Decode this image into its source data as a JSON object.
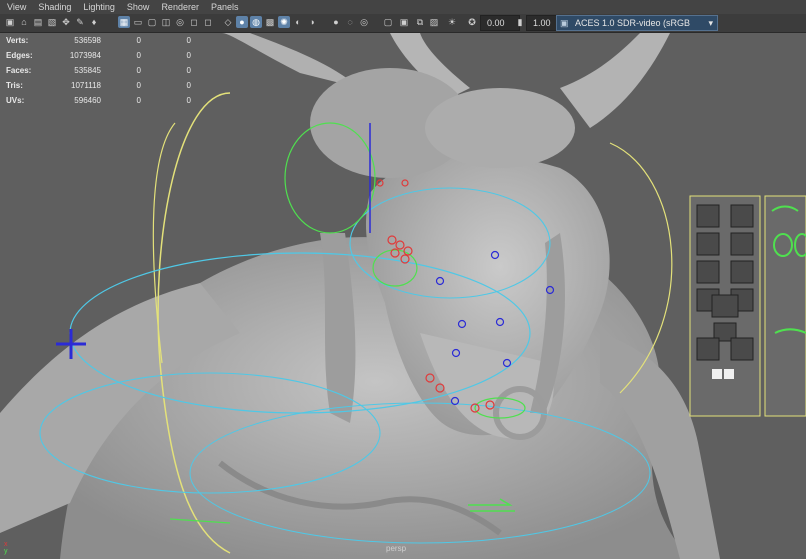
{
  "menu": [
    "View",
    "Shading",
    "Lighting",
    "Show",
    "Renderer",
    "Panels"
  ],
  "toolbar": {
    "exposure": "0.00",
    "gamma": "1.00",
    "colorspace": "ACES 1.0 SDR-video (sRGB"
  },
  "hud": {
    "rows": [
      {
        "label": "Verts:",
        "a": "536598",
        "b": "0",
        "c": "0"
      },
      {
        "label": "Edges:",
        "a": "1073984",
        "b": "0",
        "c": "0"
      },
      {
        "label": "Faces:",
        "a": "535845",
        "b": "0",
        "c": "0"
      },
      {
        "label": "Tris:",
        "a": "1071118",
        "b": "0",
        "c": "0"
      },
      {
        "label": "UVs:",
        "a": "596460",
        "b": "0",
        "c": "0"
      }
    ]
  },
  "camera": "persp",
  "colors": {
    "bg": "#5f5f5f",
    "model": "#b5b5b5",
    "curve_yellow": "#e3e17a",
    "curve_cyan": "#4fc8e6",
    "curve_green": "#4fe04f",
    "ctrl_blue": "#2b2bd6",
    "ctrl_red": "#e03a3a"
  },
  "icons": [
    "select-icon",
    "camera-icon",
    "grid-icon",
    "wireframe-icon",
    "shaded-icon",
    "textured-icon",
    "light-icon",
    "shadow-icon",
    "xray-icon",
    "isolate-icon",
    "exposure-icon",
    "gamma-icon",
    "colorspace-icon"
  ]
}
